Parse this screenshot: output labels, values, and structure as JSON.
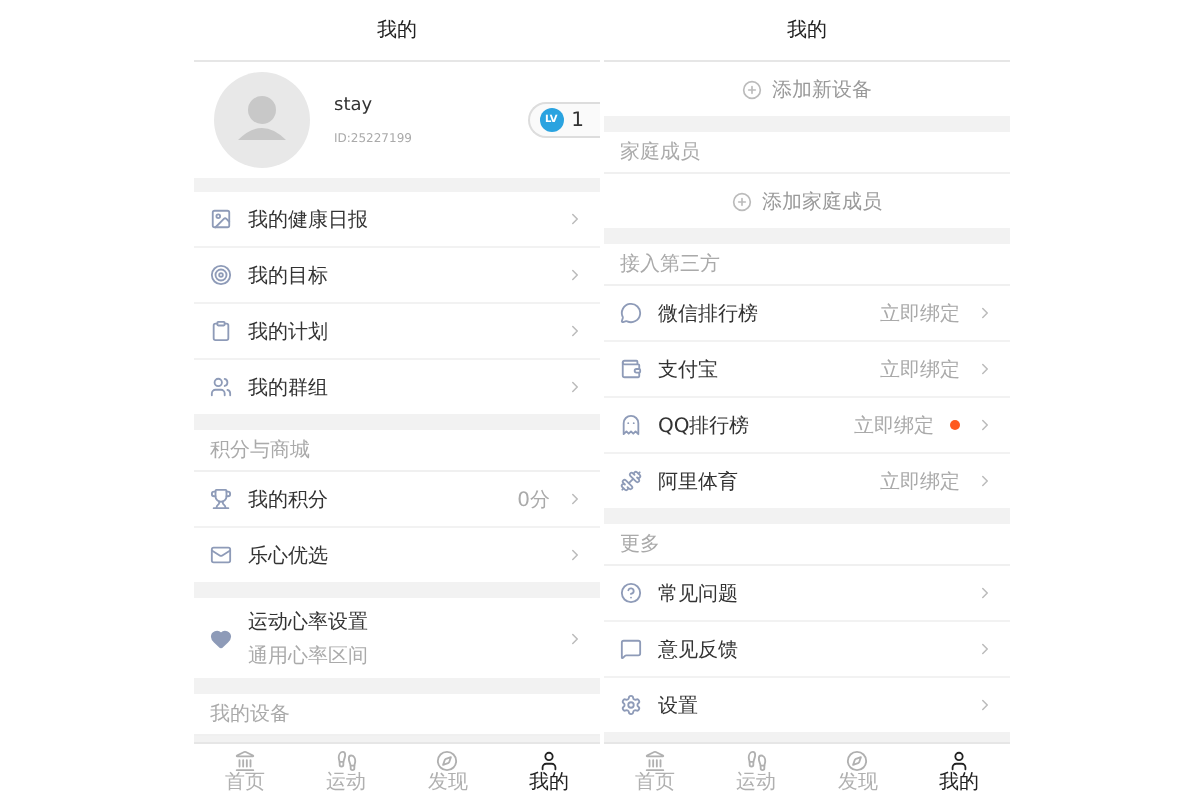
{
  "phones": [
    {
      "title": "我的",
      "sections": [
        {
          "kind": "profile",
          "name": "stay",
          "user_id": "ID:25227199",
          "level_tag": "LV",
          "level": "1"
        },
        {
          "kind": "list",
          "rows": [
            {
              "kind": "link",
              "label": "我的健康日报"
            },
            {
              "kind": "link",
              "label": "我的目标"
            },
            {
              "kind": "link",
              "label": "我的计划"
            },
            {
              "kind": "link",
              "label": "我的群组"
            }
          ]
        },
        {
          "kind": "list",
          "label": "积分与商城",
          "rows": [
            {
              "kind": "link",
              "label": "我的积分",
              "value": "0分"
            },
            {
              "kind": "link",
              "label": "乐心优选"
            }
          ]
        },
        {
          "kind": "list",
          "rows": [
            {
              "kind": "link",
              "label": "运动心率设置",
              "subtitle": "通用心率区间"
            }
          ]
        },
        {
          "kind": "list",
          "label": "我的设备"
        }
      ],
      "tabs": [
        {
          "label": "首页",
          "selected": false
        },
        {
          "label": "运动",
          "selected": false
        },
        {
          "label": "发现",
          "selected": false
        },
        {
          "label": "我的",
          "selected": true
        }
      ]
    },
    {
      "title": "我的",
      "sections": [
        {
          "kind": "list",
          "rows": [
            {
              "kind": "add",
              "label": "添加新设备"
            }
          ]
        },
        {
          "kind": "list",
          "label": "家庭成员",
          "rows": [
            {
              "kind": "add",
              "label": "添加家庭成员"
            }
          ]
        },
        {
          "kind": "list",
          "label": "接入第三方",
          "rows": [
            {
              "kind": "link",
              "label": "微信排行榜",
              "value": "立即绑定",
              "dot": false
            },
            {
              "kind": "link",
              "label": "支付宝",
              "value": "立即绑定",
              "dot": false
            },
            {
              "kind": "link",
              "label": "QQ排行榜",
              "value": "立即绑定",
              "dot": true
            },
            {
              "kind": "link",
              "label": "阿里体育",
              "value": "立即绑定",
              "dot": false
            }
          ]
        },
        {
          "kind": "list",
          "label": "更多",
          "rows": [
            {
              "kind": "link",
              "label": "常见问题"
            },
            {
              "kind": "link",
              "label": "意见反馈"
            },
            {
              "kind": "link",
              "label": "设置"
            }
          ]
        }
      ],
      "tabs": [
        {
          "label": "首页",
          "selected": false
        },
        {
          "label": "运动",
          "selected": false
        },
        {
          "label": "发现",
          "selected": false
        },
        {
          "label": "我的",
          "selected": true
        }
      ]
    }
  ]
}
